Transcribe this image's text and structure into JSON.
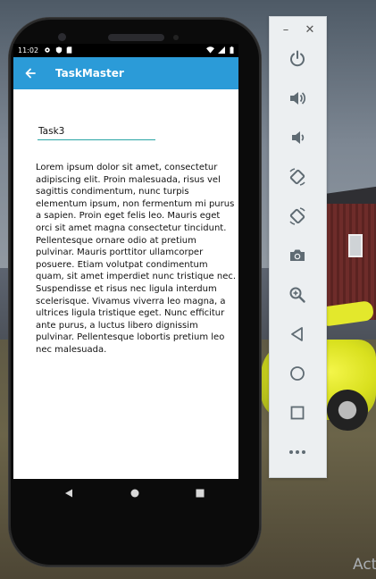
{
  "status_bar": {
    "time": "11:02",
    "left_icons": [
      "gear-icon",
      "shield-icon",
      "sd-card-icon"
    ],
    "right_icons": [
      "wifi-icon",
      "signal-icon",
      "battery-icon"
    ]
  },
  "app_bar": {
    "title": "TaskMaster",
    "back_icon": "arrow-back-icon",
    "color": "#2b9bd8"
  },
  "task": {
    "title_value": "Task3",
    "description": "Lorem ipsum dolor sit amet, consectetur adipiscing elit. Proin malesuada, risus vel sagittis condimentum, nunc turpis elementum ipsum, non fermentum mi purus a sapien. Proin eget felis leo. Mauris eget orci sit amet magna consectetur tincidunt. Pellentesque ornare odio at pretium pulvinar. Mauris porttitor ullamcorper posuere. Etiam volutpat condimentum quam, sit amet imperdiet nunc tristique nec. Suspendisse et risus nec ligula interdum scelerisque. Vivamus viverra leo magna, a ultrices ligula tristique eget. Nunc efficitur ante purus, a luctus libero dignissim pulvinar. Pellentesque lobortis pretium leo nec malesuada."
  },
  "nav_bar": [
    "back-triangle-icon",
    "home-circle-icon",
    "overview-square-icon"
  ],
  "emulator_panel": {
    "window_controls": [
      "minimize-icon",
      "close-icon"
    ],
    "window_symbols": {
      "minimize": "–",
      "close": "✕"
    },
    "tools": [
      "power-icon",
      "volume-up-icon",
      "volume-down-icon",
      "rotate-left-icon",
      "rotate-right-icon",
      "camera-icon",
      "zoom-icon",
      "back-icon",
      "home-icon",
      "overview-icon",
      "more-icon"
    ]
  },
  "desktop": {
    "watermark": "Act"
  }
}
